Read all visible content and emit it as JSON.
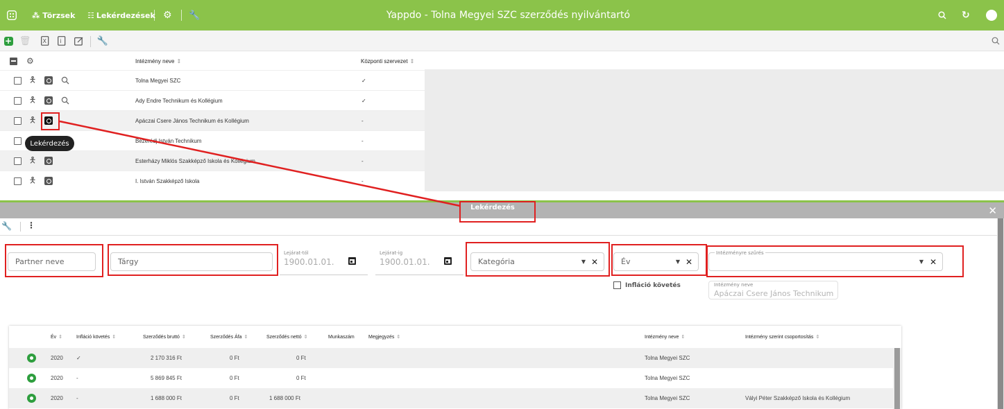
{
  "header": {
    "title": "Yappdo - Tolna Megyei SZC szerződés nyilvántartó",
    "nav": [
      {
        "label": "Törzsek",
        "icon": "tree-icon"
      },
      {
        "label": "Lekérdezések",
        "icon": "query-icon"
      }
    ]
  },
  "institutions_table": {
    "columns": [
      "Intézmény neve",
      "Központi szervezet"
    ],
    "rows": [
      {
        "name": "Tolna Megyei SZC",
        "central": "✓"
      },
      {
        "name": "Ady Endre Technikum és Kollégium",
        "central": "✓"
      },
      {
        "name": "Apáczai Csere János Technikum és Kollégium",
        "central": "-"
      },
      {
        "name": "Bezerédj István Technikum",
        "central": "-"
      },
      {
        "name": "Esterházy Miklós Szakképző Iskola és Kollégium",
        "central": "-"
      },
      {
        "name": "I. István Szakképző Iskola",
        "central": "-"
      }
    ],
    "tooltip": "Lekérdezés"
  },
  "modal": {
    "title": "Lekérdezés",
    "filters": {
      "partner_placeholder": "Partner neve",
      "subject_placeholder": "Tárgy",
      "date_from_label": "Lejárat-tól",
      "date_from_value": "1900.01.01.",
      "date_to_label": "Lejárat-ig",
      "date_to_value": "1900.01.01.",
      "category_placeholder": "Kategória",
      "year_placeholder": "Év",
      "institution_filter_label": "Intézményre szűrés",
      "inflation_label": "Infláció követés",
      "institution_name_label": "Intézmény neve",
      "institution_name_value": "Apáczai Csere János Technikum"
    },
    "table": {
      "columns": [
        "Év",
        "Infláció követés",
        "Szerződés bruttó",
        "Szerződés Áfa",
        "Szerződés nettó",
        "Munkaszám",
        "Megjegyzés",
        "Intézmény neve",
        "Intézmény szerint csoportosítás"
      ],
      "rows": [
        {
          "year": "2020",
          "inflation": "✓",
          "gross": "2 170 316 Ft",
          "vat": "0 Ft",
          "net": "0 Ft",
          "institution": "Tolna Megyei SZC",
          "group": ""
        },
        {
          "year": "2020",
          "inflation": "-",
          "gross": "5 869 845 Ft",
          "vat": "0 Ft",
          "net": "0 Ft",
          "institution": "Tolna Megyei SZC",
          "group": ""
        },
        {
          "year": "2020",
          "inflation": "-",
          "gross": "1 688 000 Ft",
          "vat": "0 Ft",
          "net": "1 688 000 Ft",
          "institution": "Tolna Megyei SZC",
          "group": "Vályi Péter Szakképző Iskola és Kollégium"
        }
      ]
    }
  },
  "colors": {
    "brand": "#8bc34a",
    "annotation": "#e02020",
    "eye": "#2e9e3e"
  }
}
